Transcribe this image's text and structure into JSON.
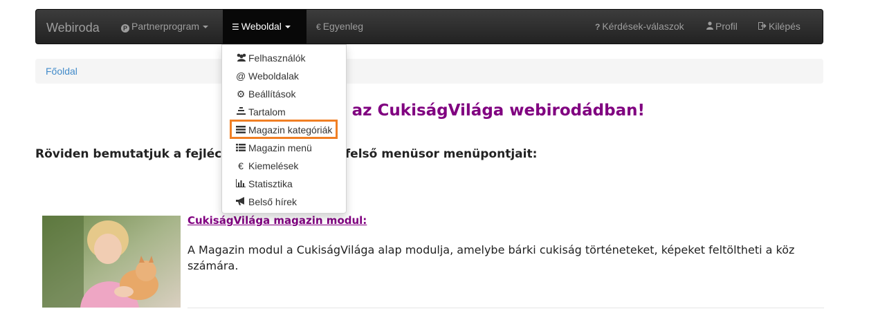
{
  "navbar": {
    "brand": "Webiroda",
    "items": [
      {
        "label": "Partnerprogram",
        "icon": "partnerprogram-p-icon",
        "has_caret": true
      },
      {
        "label": "Weboldal",
        "icon": "weboldal-icon",
        "has_caret": true,
        "active": true
      },
      {
        "label": "Egyenleg",
        "icon": "euro-icon",
        "prefix": "€"
      },
      {
        "label": "Kérdések-válaszok",
        "icon": "question-icon",
        "prefix": "?"
      },
      {
        "label": "Profil",
        "icon": "user-icon"
      },
      {
        "label": "Kilépés",
        "icon": "logout-icon"
      }
    ]
  },
  "breadcrumb": {
    "home": "Főoldal"
  },
  "main": {
    "welcome": "Üdvözöljük az CukiságVilága webirodádban!",
    "intro": "Röviden bemutatjuk a fejléc alatt található legfelső menüsor menüpontjait:",
    "article": {
      "title": "CukiságVilága magazin modul:",
      "text": "A Magazin modul a CukiságVilága alap modulja, amelybe bárki cukiság történeteket, képeket feltöltheti a köz számára."
    }
  },
  "dropdown": {
    "items": [
      {
        "label": "Felhasználók",
        "icon": "users-icon",
        "glyph": "👥"
      },
      {
        "label": "Weboldalak",
        "icon": "at-icon",
        "glyph": "@"
      },
      {
        "label": "Beállítások",
        "icon": "gear-icon",
        "glyph": "⚙"
      },
      {
        "label": "Tartalom",
        "icon": "content-icon",
        "glyph": "☰"
      },
      {
        "label": "Magazin kategóriák",
        "icon": "list-icon",
        "glyph": "☰",
        "highlighted": true
      },
      {
        "label": "Magazin menü",
        "icon": "list-ul-icon",
        "glyph": "☰"
      },
      {
        "label": "Kiemelések",
        "icon": "euro-icon",
        "glyph": "€"
      },
      {
        "label": "Statisztika",
        "icon": "chart-icon",
        "glyph": "▥"
      },
      {
        "label": "Belső hírek",
        "icon": "megaphone-icon",
        "glyph": "📢"
      }
    ]
  },
  "colors": {
    "navbar_bg": "#222222",
    "accent_purple": "#800080",
    "link_blue": "#428bca",
    "highlight_orange": "#f07f24"
  }
}
